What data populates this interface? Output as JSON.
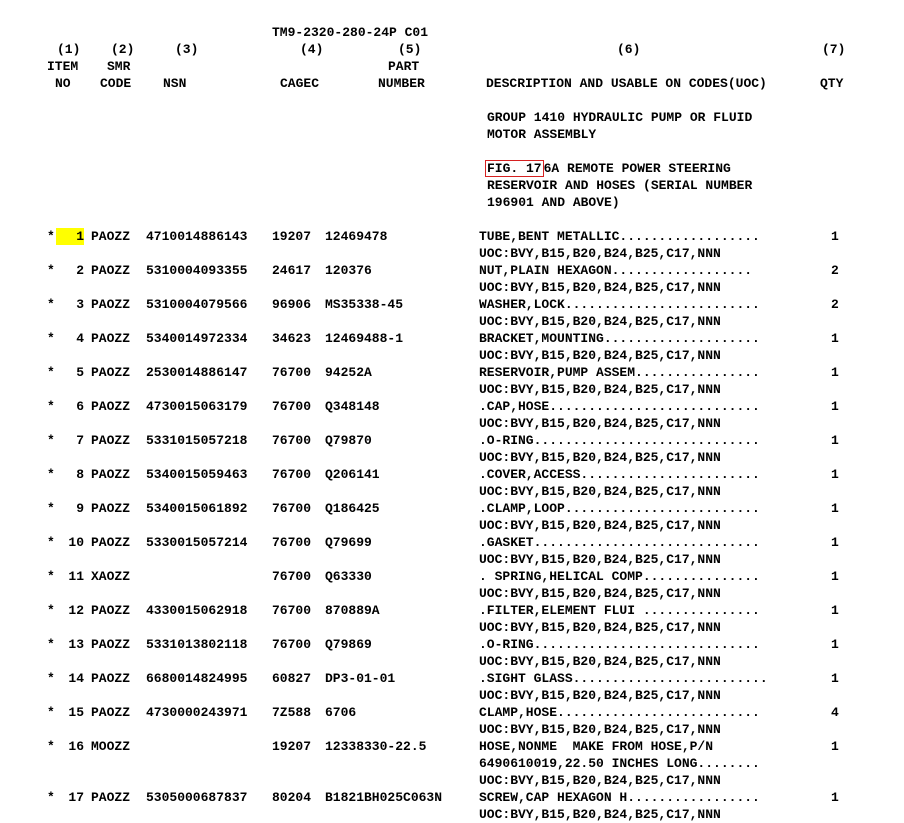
{
  "doc": {
    "title": "TM9-2320-280-24P C01",
    "columns": {
      "c1_num": "(1)",
      "c1_a": "ITEM",
      "c1_b": "NO",
      "c2_num": "(2)",
      "c2_a": "SMR",
      "c2_b": "CODE",
      "c3_num": "(3)",
      "c3_b": "NSN",
      "c4_num": "(4)",
      "c4_b": "CAGEC",
      "c5_num": "(5)",
      "c5_a": "PART",
      "c5_b": "NUMBER",
      "c6_num": "(6)",
      "c6_b": "DESCRIPTION AND USABLE ON CODES(UOC)",
      "c7_num": "(7)",
      "c7_b": "QTY"
    },
    "group_lines": [
      "GROUP 1410 HYDRAULIC PUMP OR FLUID",
      "MOTOR ASSEMBLY"
    ],
    "fig_label": "FIG. 17",
    "fig_rest": "6A REMOTE POWER STEERING",
    "fig_lines": [
      "RESERVOIR AND HOSES (SERIAL NUMBER",
      "196901 AND ABOVE)"
    ]
  },
  "items": [
    {
      "star": "*",
      "no": "1",
      "smr": "PAOZZ",
      "nsn": "4710014886143",
      "cage": "19207",
      "part": "12469478",
      "desc": [
        "TUBE,BENT METALLIC..................",
        "UOC:BVY,B15,B20,B24,B25,C17,NNN"
      ],
      "qty": "1"
    },
    {
      "star": "*",
      "no": "2",
      "smr": "PAOZZ",
      "nsn": "5310004093355",
      "cage": "24617",
      "part": "120376",
      "desc": [
        "NUT,PLAIN HEXAGON..................",
        "UOC:BVY,B15,B20,B24,B25,C17,NNN"
      ],
      "qty": "2"
    },
    {
      "star": "*",
      "no": "3",
      "smr": "PAOZZ",
      "nsn": "5310004079566",
      "cage": "96906",
      "part": "MS35338-45",
      "desc": [
        "WASHER,LOCK.........................",
        "UOC:BVY,B15,B20,B24,B25,C17,NNN"
      ],
      "qty": "2"
    },
    {
      "star": "*",
      "no": "4",
      "smr": "PAOZZ",
      "nsn": "5340014972334",
      "cage": "34623",
      "part": "12469488-1",
      "desc": [
        "BRACKET,MOUNTING....................",
        "UOC:BVY,B15,B20,B24,B25,C17,NNN"
      ],
      "qty": "1"
    },
    {
      "star": "*",
      "no": "5",
      "smr": "PAOZZ",
      "nsn": "2530014886147",
      "cage": "76700",
      "part": "94252A",
      "desc": [
        "RESERVOIR,PUMP ASSEM................",
        "UOC:BVY,B15,B20,B24,B25,C17,NNN"
      ],
      "qty": "1"
    },
    {
      "star": "*",
      "no": "6",
      "smr": "PAOZZ",
      "nsn": "4730015063179",
      "cage": "76700",
      "part": "Q348148",
      "desc": [
        ".CAP,HOSE...........................",
        "UOC:BVY,B15,B20,B24,B25,C17,NNN"
      ],
      "qty": "1"
    },
    {
      "star": "*",
      "no": "7",
      "smr": "PAOZZ",
      "nsn": "5331015057218",
      "cage": "76700",
      "part": "Q79870",
      "desc": [
        ".O-RING.............................",
        "UOC:BVY,B15,B20,B24,B25,C17,NNN"
      ],
      "qty": "1"
    },
    {
      "star": "*",
      "no": "8",
      "smr": "PAOZZ",
      "nsn": "5340015059463",
      "cage": "76700",
      "part": "Q206141",
      "desc": [
        ".COVER,ACCESS.......................",
        "UOC:BVY,B15,B20,B24,B25,C17,NNN"
      ],
      "qty": "1"
    },
    {
      "star": "*",
      "no": "9",
      "smr": "PAOZZ",
      "nsn": "5340015061892",
      "cage": "76700",
      "part": "Q186425",
      "desc": [
        ".CLAMP,LOOP.........................",
        "UOC:BVY,B15,B20,B24,B25,C17,NNN"
      ],
      "qty": "1"
    },
    {
      "star": "*",
      "no": "10",
      "smr": "PAOZZ",
      "nsn": "5330015057214",
      "cage": "76700",
      "part": "Q79699",
      "desc": [
        ".GASKET.............................",
        "UOC:BVY,B15,B20,B24,B25,C17,NNN"
      ],
      "qty": "1"
    },
    {
      "star": "*",
      "no": "11",
      "smr": "XAOZZ",
      "nsn": "",
      "cage": "76700",
      "part": "Q63330",
      "desc": [
        ". SPRING,HELICAL COMP...............",
        "UOC:BVY,B15,B20,B24,B25,C17,NNN"
      ],
      "qty": "1"
    },
    {
      "star": "*",
      "no": "12",
      "smr": "PAOZZ",
      "nsn": "4330015062918",
      "cage": "76700",
      "part": "870889A",
      "desc": [
        ".FILTER,ELEMENT FLUI ...............",
        "UOC:BVY,B15,B20,B24,B25,C17,NNN"
      ],
      "qty": "1"
    },
    {
      "star": "*",
      "no": "13",
      "smr": "PAOZZ",
      "nsn": "5331013802118",
      "cage": "76700",
      "part": "Q79869",
      "desc": [
        ".O-RING.............................",
        "UOC:BVY,B15,B20,B24,B25,C17,NNN"
      ],
      "qty": "1"
    },
    {
      "star": "*",
      "no": "14",
      "smr": "PAOZZ",
      "nsn": "6680014824995",
      "cage": "60827",
      "part": "DP3-01-01",
      "desc": [
        ".SIGHT GLASS.........................",
        "UOC:BVY,B15,B20,B24,B25,C17,NNN"
      ],
      "qty": "1"
    },
    {
      "star": "*",
      "no": "15",
      "smr": "PAOZZ",
      "nsn": "4730000243971",
      "cage": "7Z588",
      "part": "6706",
      "desc": [
        "CLAMP,HOSE..........................",
        "UOC:BVY,B15,B20,B24,B25,C17,NNN"
      ],
      "qty": "4"
    },
    {
      "star": "*",
      "no": "16",
      "smr": "MOOZZ",
      "nsn": "",
      "cage": "19207",
      "part": "12338330-22.5",
      "desc": [
        "HOSE,NONME  MAKE FROM HOSE,P/N",
        "6490610019,22.50 INCHES LONG........",
        "UOC:BVY,B15,B20,B24,B25,C17,NNN"
      ],
      "qty": "1"
    },
    {
      "star": "*",
      "no": "17",
      "smr": "PAOZZ",
      "nsn": "5305000687837",
      "cage": "80204",
      "part": "B1821BH025C063N",
      "desc": [
        "SCREW,CAP HEXAGON H.................",
        "UOC:BVY,B15,B20,B24,B25,C17,NNN"
      ],
      "qty": "1"
    }
  ]
}
